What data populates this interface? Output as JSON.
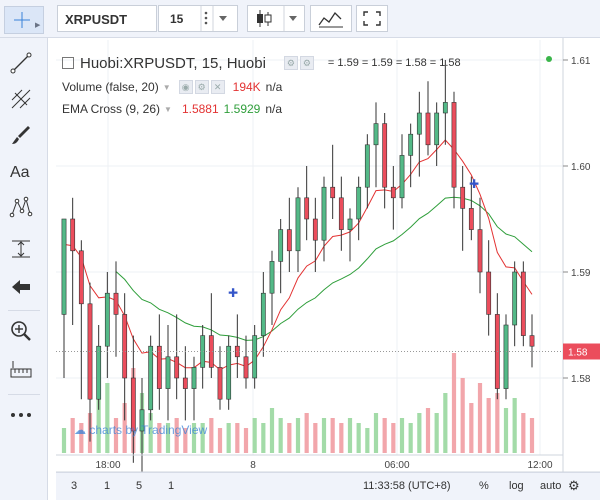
{
  "toolbar": {
    "symbol": "XRPUSDT",
    "interval": "15",
    "tools": [
      "crosshair-icon",
      "trend-line-icon",
      "fib-icon",
      "brush-icon",
      "text-icon",
      "pattern-icon",
      "measure-icon",
      "back-arrow-icon",
      "zoom-icon",
      "ruler-icon",
      "more-icon"
    ]
  },
  "legend": {
    "title": "Huobi:XRPUSDT, 15, Huobi",
    "ohlc": "= 1.59 = 1.59 = 1.58 = 1.58",
    "volume_label": "Volume (false, 20)",
    "volume_value": "194K",
    "volume_na": "n/a",
    "ema_label": "EMA Cross (9, 26)",
    "ema_fast": "1.5881",
    "ema_slow": "1.5929",
    "ema_na": "n/a"
  },
  "watermark": "charts by TradingView",
  "price_axis": {
    "ticks": [
      "1.61",
      "1.60",
      "1.59",
      "1.58"
    ],
    "current": "1.58"
  },
  "time_axis": [
    "18:00",
    "8",
    "06:00",
    "12:00"
  ],
  "bottom": {
    "ranges": [
      "3",
      "1",
      "5",
      "1"
    ],
    "clock": "11:33:58 (UTC+8)",
    "percent": "%",
    "log": "log",
    "auto": "auto"
  },
  "colors": {
    "up": "#53b987",
    "down": "#eb4d5c",
    "ema_fast": "#e33333",
    "ema_slow": "#2e9e3a"
  },
  "chart_data": {
    "type": "candlestick",
    "ylim": [
      1.572,
      1.612
    ],
    "candles": [
      [
        1.586,
        1.595,
        1.58,
        1.595
      ],
      [
        1.595,
        1.597,
        1.585,
        1.592
      ],
      [
        1.592,
        1.593,
        1.578,
        1.587
      ],
      [
        1.587,
        1.589,
        1.574,
        1.578
      ],
      [
        1.578,
        1.585,
        1.577,
        1.583
      ],
      [
        1.583,
        1.59,
        1.58,
        1.588
      ],
      [
        1.588,
        1.591,
        1.582,
        1.586
      ],
      [
        1.586,
        1.588,
        1.576,
        1.58
      ],
      [
        1.58,
        1.584,
        1.572,
        1.575
      ],
      [
        1.575,
        1.58,
        1.57,
        1.577
      ],
      [
        1.577,
        1.584,
        1.576,
        1.583
      ],
      [
        1.583,
        1.586,
        1.577,
        1.579
      ],
      [
        1.579,
        1.585,
        1.576,
        1.582
      ],
      [
        1.582,
        1.586,
        1.578,
        1.58
      ],
      [
        1.58,
        1.583,
        1.576,
        1.579
      ],
      [
        1.579,
        1.582,
        1.576,
        1.581
      ],
      [
        1.581,
        1.585,
        1.579,
        1.584
      ],
      [
        1.584,
        1.588,
        1.58,
        1.581
      ],
      [
        1.581,
        1.583,
        1.577,
        1.578
      ],
      [
        1.578,
        1.584,
        1.577,
        1.583
      ],
      [
        1.583,
        1.586,
        1.58,
        1.582
      ],
      [
        1.582,
        1.584,
        1.579,
        1.58
      ],
      [
        1.58,
        1.585,
        1.579,
        1.584
      ],
      [
        1.584,
        1.59,
        1.582,
        1.588
      ],
      [
        1.588,
        1.592,
        1.585,
        1.591
      ],
      [
        1.591,
        1.595,
        1.588,
        1.594
      ],
      [
        1.594,
        1.597,
        1.59,
        1.592
      ],
      [
        1.592,
        1.598,
        1.59,
        1.597
      ],
      [
        1.597,
        1.6,
        1.593,
        1.595
      ],
      [
        1.595,
        1.597,
        1.59,
        1.593
      ],
      [
        1.593,
        1.599,
        1.591,
        1.598
      ],
      [
        1.598,
        1.602,
        1.595,
        1.597
      ],
      [
        1.597,
        1.599,
        1.592,
        1.594
      ],
      [
        1.594,
        1.596,
        1.591,
        1.595
      ],
      [
        1.595,
        1.599,
        1.593,
        1.598
      ],
      [
        1.598,
        1.603,
        1.596,
        1.602
      ],
      [
        1.602,
        1.606,
        1.598,
        1.604
      ],
      [
        1.604,
        1.605,
        1.596,
        1.598
      ],
      [
        1.598,
        1.6,
        1.594,
        1.597
      ],
      [
        1.597,
        1.603,
        1.596,
        1.601
      ],
      [
        1.601,
        1.604,
        1.598,
        1.603
      ],
      [
        1.603,
        1.607,
        1.599,
        1.605
      ],
      [
        1.605,
        1.608,
        1.601,
        1.602
      ],
      [
        1.602,
        1.606,
        1.6,
        1.605
      ],
      [
        1.605,
        1.61,
        1.602,
        1.606
      ],
      [
        1.606,
        1.607,
        1.596,
        1.598
      ],
      [
        1.598,
        1.6,
        1.592,
        1.596
      ],
      [
        1.596,
        1.599,
        1.593,
        1.594
      ],
      [
        1.594,
        1.597,
        1.588,
        1.59
      ],
      [
        1.59,
        1.593,
        1.584,
        1.586
      ],
      [
        1.586,
        1.588,
        1.578,
        1.579
      ],
      [
        1.579,
        1.586,
        1.578,
        1.585
      ],
      [
        1.585,
        1.591,
        1.583,
        1.59
      ],
      [
        1.59,
        1.591,
        1.583,
        1.584
      ],
      [
        1.584,
        1.586,
        1.581,
        1.583
      ]
    ],
    "volume": [
      0.25,
      0.35,
      0.3,
      0.4,
      0.55,
      0.7,
      0.35,
      0.5,
      0.85,
      0.6,
      0.4,
      0.3,
      0.3,
      0.35,
      0.25,
      0.3,
      0.3,
      0.35,
      0.25,
      0.3,
      0.3,
      0.25,
      0.35,
      0.3,
      0.45,
      0.35,
      0.3,
      0.35,
      0.4,
      0.3,
      0.35,
      0.35,
      0.3,
      0.35,
      0.3,
      0.25,
      0.4,
      0.35,
      0.3,
      0.35,
      0.3,
      0.4,
      0.45,
      0.4,
      0.6,
      1.0,
      0.75,
      0.5,
      0.7,
      0.55,
      0.6,
      0.45,
      0.55,
      0.4,
      0.35
    ]
  }
}
